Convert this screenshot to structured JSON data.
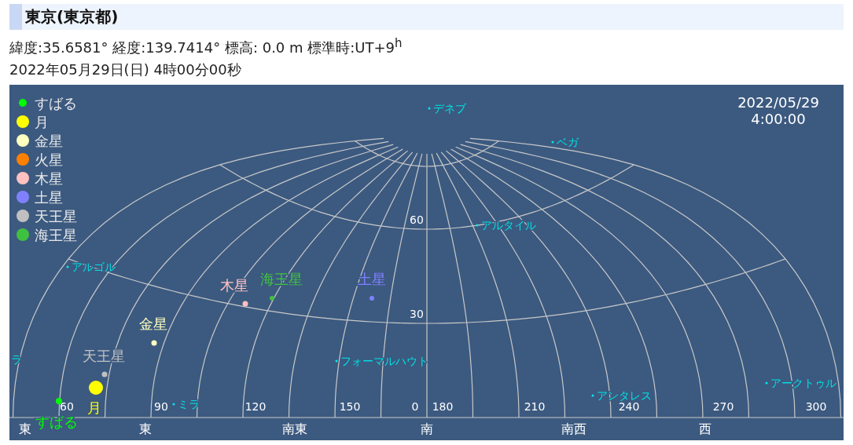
{
  "location": {
    "title": "東京(東京都)",
    "coordinates": "緯度:35.6581° 経度:139.7414° 標高: 0.0 m 標準時:UT+9$^{h}$",
    "datetime": "2022年05月29日(日) 4時00分00秒"
  },
  "sky_chart": {
    "date": "2022/05/29",
    "time": "4:00:00",
    "legend": [
      {
        "name": "すばる",
        "color": "#00ff00"
      },
      {
        "name": "月",
        "color": "#ffff00"
      },
      {
        "name": "金星",
        "color": "#ffffc0"
      },
      {
        "name": "火星",
        "color": "#ff8000"
      },
      {
        "name": "木星",
        "color": "#ffc0c0"
      },
      {
        "name": "土星",
        "color": "#8080ff"
      },
      {
        "name": "天王星",
        "color": "#c0c0c0"
      },
      {
        "name": "海王星",
        "color": "#40c040"
      }
    ],
    "objects": [
      {
        "name": "すばる",
        "color": "#00ff00"
      },
      {
        "name": "月",
        "color": "#ffff00"
      },
      {
        "name": "天王星",
        "color": "#c0c0c0"
      },
      {
        "name": "金星",
        "color": "#ffffc0"
      },
      {
        "name": "木星",
        "color": "#ffc0c0"
      },
      {
        "name": "海王星",
        "color": "#40c040"
      },
      {
        "name": "土星",
        "color": "#8080ff"
      }
    ],
    "stars": [
      "デネブ",
      "ベガ",
      "アルタイル",
      "アルゴル",
      "ラ",
      "フォーマルハウト",
      "ミラ",
      "アンタレス",
      "アークトゥル"
    ],
    "altitude_labels": [
      "60",
      "30"
    ],
    "azimuth_labels": [
      "60",
      "90",
      "120",
      "150",
      "0",
      "180",
      "210",
      "240",
      "270",
      "300"
    ],
    "directions": [
      "東",
      "東",
      "南東",
      "南",
      "南西",
      "西"
    ]
  }
}
